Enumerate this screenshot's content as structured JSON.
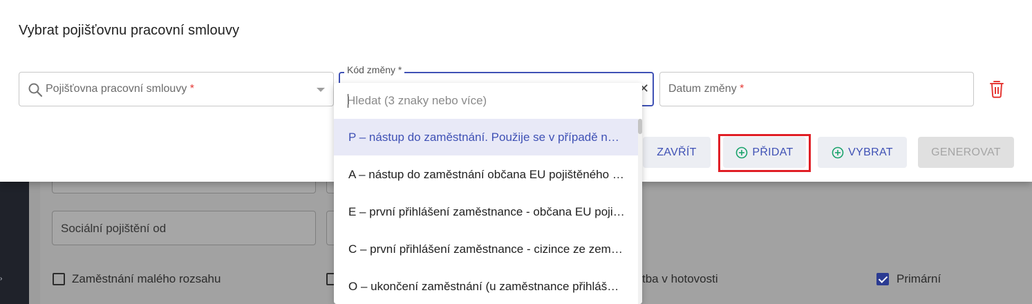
{
  "modal": {
    "title": "Vybrat pojišťovnu pracovní smlouvy",
    "fields": {
      "insurer": {
        "label": "Pojišťovna pracovní smlouvy",
        "required_mark": "*"
      },
      "change_code": {
        "legend": "Kód změny *"
      },
      "change_date": {
        "label": "Datum změny",
        "required_mark": "*"
      }
    },
    "buttons": {
      "close": "ZAVŘÍT",
      "add": "PŘIDAT",
      "select": "VYBRAT",
      "generate": "GENEROVAT"
    },
    "dropdown": {
      "search_placeholder": "Hledat (3 znaky nebo více)",
      "options": [
        "P – nástup do zaměstnání. Použije se v případě nástupu do zaměstnání",
        "A – nástup do zaměstnání občana EU pojištěného v cizině",
        "E – první přihlášení zaměstnance - občana EU pojištěného v cizině",
        "C – první přihlášení zaměstnance - cizince ze země mimo EU",
        "O – ukončení zaměstnání (u zaměstnance přihlášeného)"
      ],
      "active_index": 0
    }
  },
  "background": {
    "social_insurance_from": "Sociální pojištění od",
    "small_scale_employment": "Zaměstnání malého rozsahu",
    "cash_payment_partial": "tba v hotovosti",
    "primary": "Primární",
    "primary_checked": true
  },
  "colors": {
    "accent": "#3f51b5",
    "danger": "#e53935",
    "highlight": "#e01f26",
    "plus_icon": "#1aa36b"
  },
  "icons": {
    "search": "search-icon",
    "caret": "caret-down-icon",
    "clear": "close-icon",
    "trash": "trash-icon",
    "plus": "plus-circle-icon"
  }
}
